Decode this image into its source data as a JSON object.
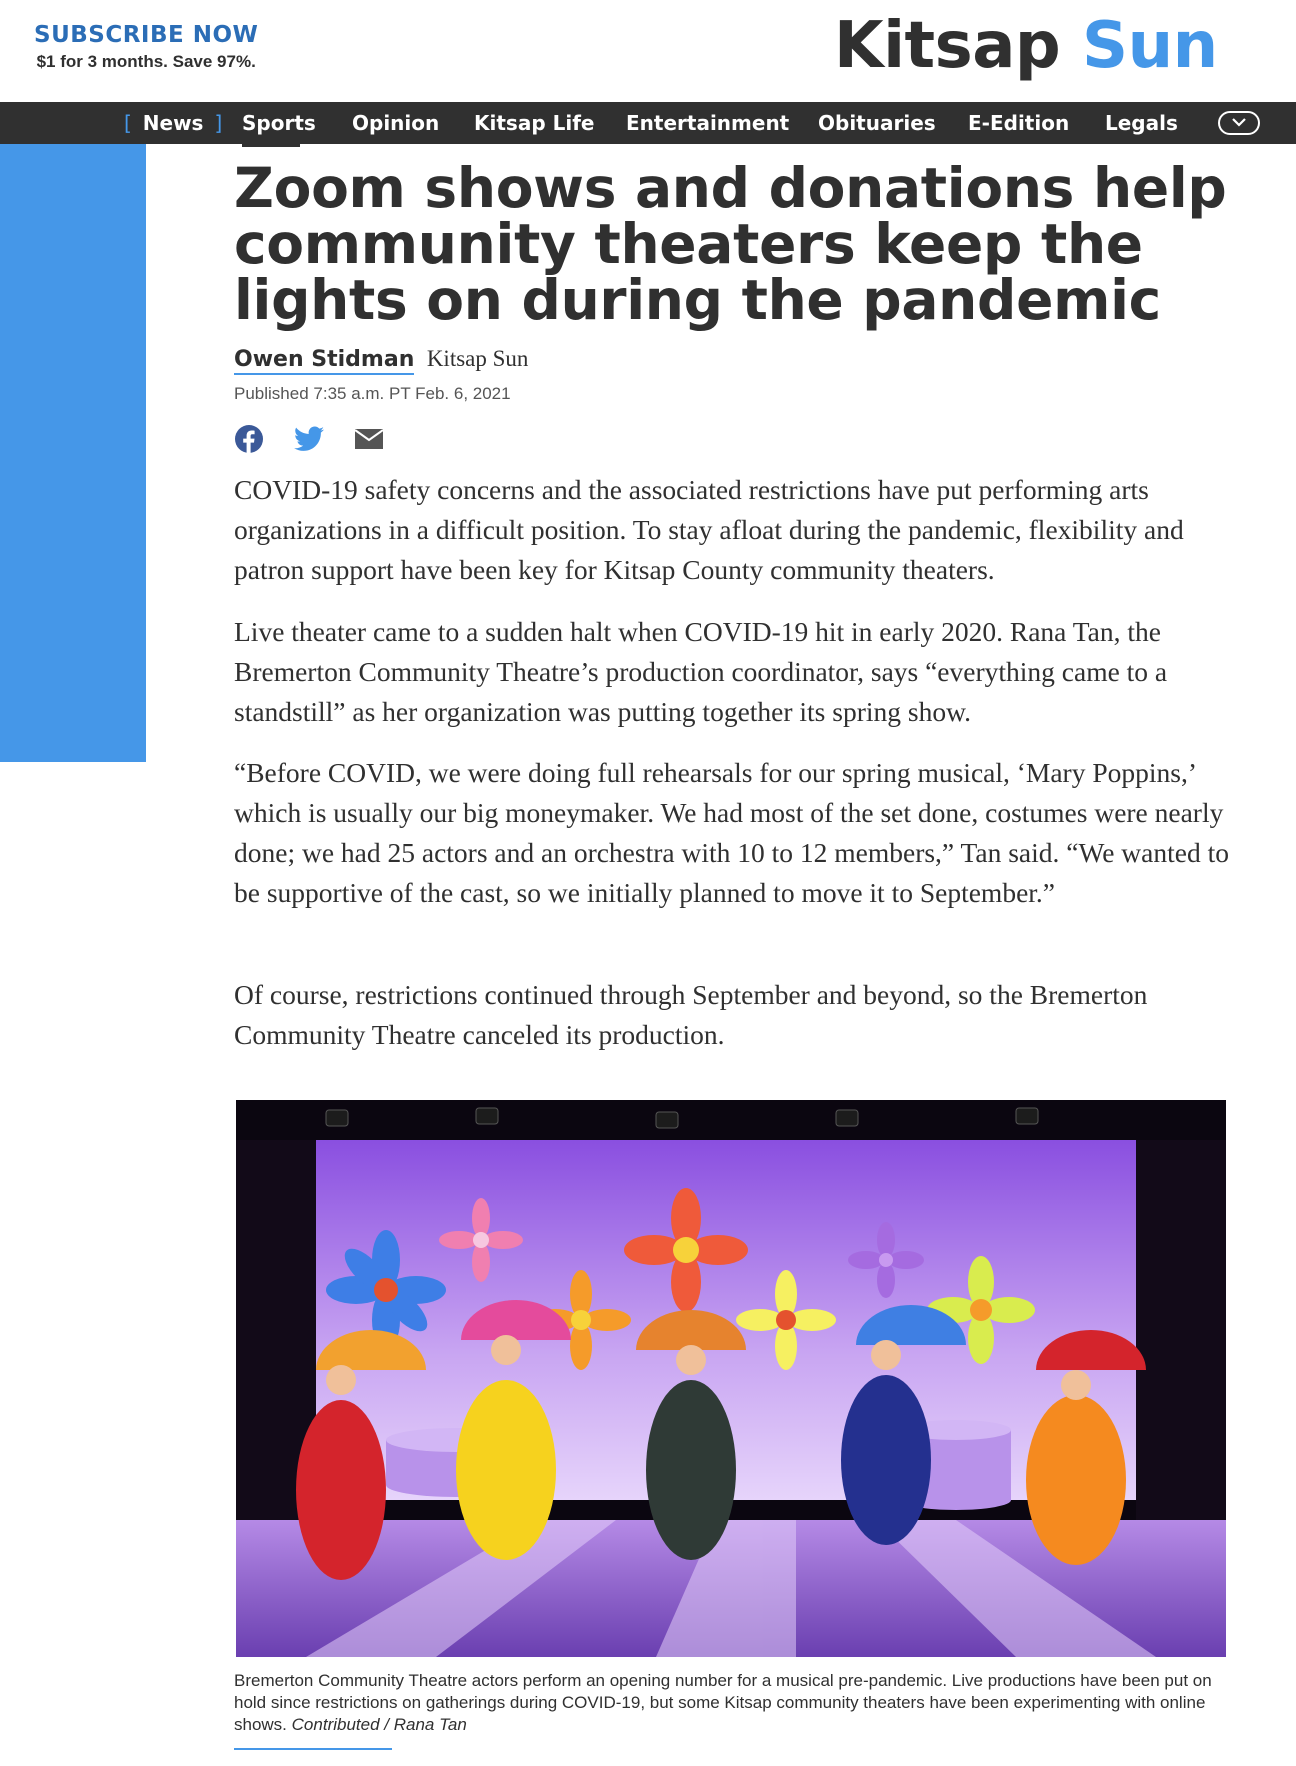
{
  "header": {
    "subscribe_title": "SUBSCRIBE NOW",
    "subscribe_sub": "$1 for 3 months. Save 97%.",
    "logo_part1": "Kitsap",
    "logo_part2": "Sun"
  },
  "nav": {
    "items": [
      "News",
      "Sports",
      "Opinion",
      "Kitsap Life",
      "Entertainment",
      "Obituaries",
      "E-Edition",
      "Legals"
    ],
    "active": "News",
    "bracket_left": "[",
    "bracket_right": "]"
  },
  "article": {
    "headline": "Zoom shows and donations help community theaters keep the lights on during the pandemic",
    "author": "Owen Stidman",
    "source": "Kitsap Sun",
    "published": "Published 7:35 a.m. PT Feb. 6, 2021",
    "paragraphs": [
      "COVID-19 safety concerns and the associated restrictions have put performing arts organizations in a difficult position. To stay afloat during the pandemic, flexibility and patron support have been key for Kitsap County community theaters.",
      "Live theater came to a sudden halt when COVID-19 hit in early 2020. Rana Tan, the Bremerton Community Theatre’s production coordinator, says “everything came to a standstill” as her organization was putting together its spring show.",
      "“Before COVID, we were doing full rehearsals for our spring musical, ‘Mary Poppins,’ which is usually our big moneymaker. We had most of the set done, costumes were nearly done; we had 25 actors and an orchestra with 10 to 12 members,” Tan said. “We wanted to be supportive of the cast, so we initially planned to move it to September.”",
      "Of course, restrictions continued through September and beyond, so the Bremerton Community Theatre canceled its production."
    ],
    "caption": "Bremerton Community Theatre actors perform an opening number for a musical pre-pandemic. Live productions have been put on hold since restrictions on gatherings during COVID-19, but some Kitsap community theaters have been experimenting with online shows.",
    "credit": "Contributed / Rana Tan"
  },
  "share_icons": [
    "facebook-icon",
    "twitter-icon",
    "email-icon"
  ],
  "colors": {
    "accent": "#4597e8",
    "subscribe_blue": "#2b6db6",
    "nav_bg": "#303030",
    "text": "#303030"
  }
}
